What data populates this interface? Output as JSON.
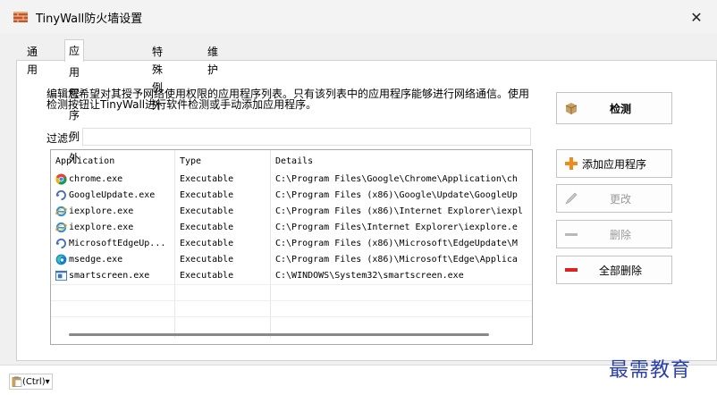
{
  "window": {
    "title": "TinyWall防火墙设置",
    "close_glyph": "✕"
  },
  "tabs": [
    "通用",
    "应用程序例外",
    "特殊例外",
    "维护"
  ],
  "description": "编辑您希望对其授予网络使用权限的应用程序列表。只有该列表中的应用程序能够进行网络通信。使用检测按钮让TinyWall进行软件检测或手动添加应用程序。",
  "filter": {
    "label": "过滤:",
    "value": ""
  },
  "table": {
    "columns": [
      "Application",
      "Type",
      "Details"
    ],
    "rows": [
      {
        "icon": "chrome-icon",
        "app": "chrome.exe",
        "type": "Executable",
        "details": "C:\\Program Files\\Google\\Chrome\\Application\\ch"
      },
      {
        "icon": "google-update-icon",
        "app": "GoogleUpdate.exe",
        "type": "Executable",
        "details": "C:\\Program Files (x86)\\Google\\Update\\GoogleUp"
      },
      {
        "icon": "ie-icon",
        "app": "iexplore.exe",
        "type": "Executable",
        "details": "C:\\Program Files (x86)\\Internet Explorer\\iexpl"
      },
      {
        "icon": "ie-icon",
        "app": "iexplore.exe",
        "type": "Executable",
        "details": "C:\\Program Files\\Internet Explorer\\iexplore.e"
      },
      {
        "icon": "edge-update-icon",
        "app": "MicrosoftEdgeUp...",
        "type": "Executable",
        "details": "C:\\Program Files (x86)\\Microsoft\\EdgeUpdate\\M"
      },
      {
        "icon": "edge-icon",
        "app": "msedge.exe",
        "type": "Executable",
        "details": "C:\\Program Files (x86)\\Microsoft\\Edge\\Applica"
      },
      {
        "icon": "smartscreen-icon",
        "app": "smartscreen.exe",
        "type": "Executable",
        "details": "C:\\WINDOWS\\System32\\smartscreen.exe"
      }
    ]
  },
  "buttons": {
    "detect": "检测",
    "add": "添加应用程序",
    "modify": "更改",
    "remove": "删除",
    "remove_all": "全部删除"
  },
  "paste_options": "(Ctrl)▾",
  "watermark": "最需教育"
}
